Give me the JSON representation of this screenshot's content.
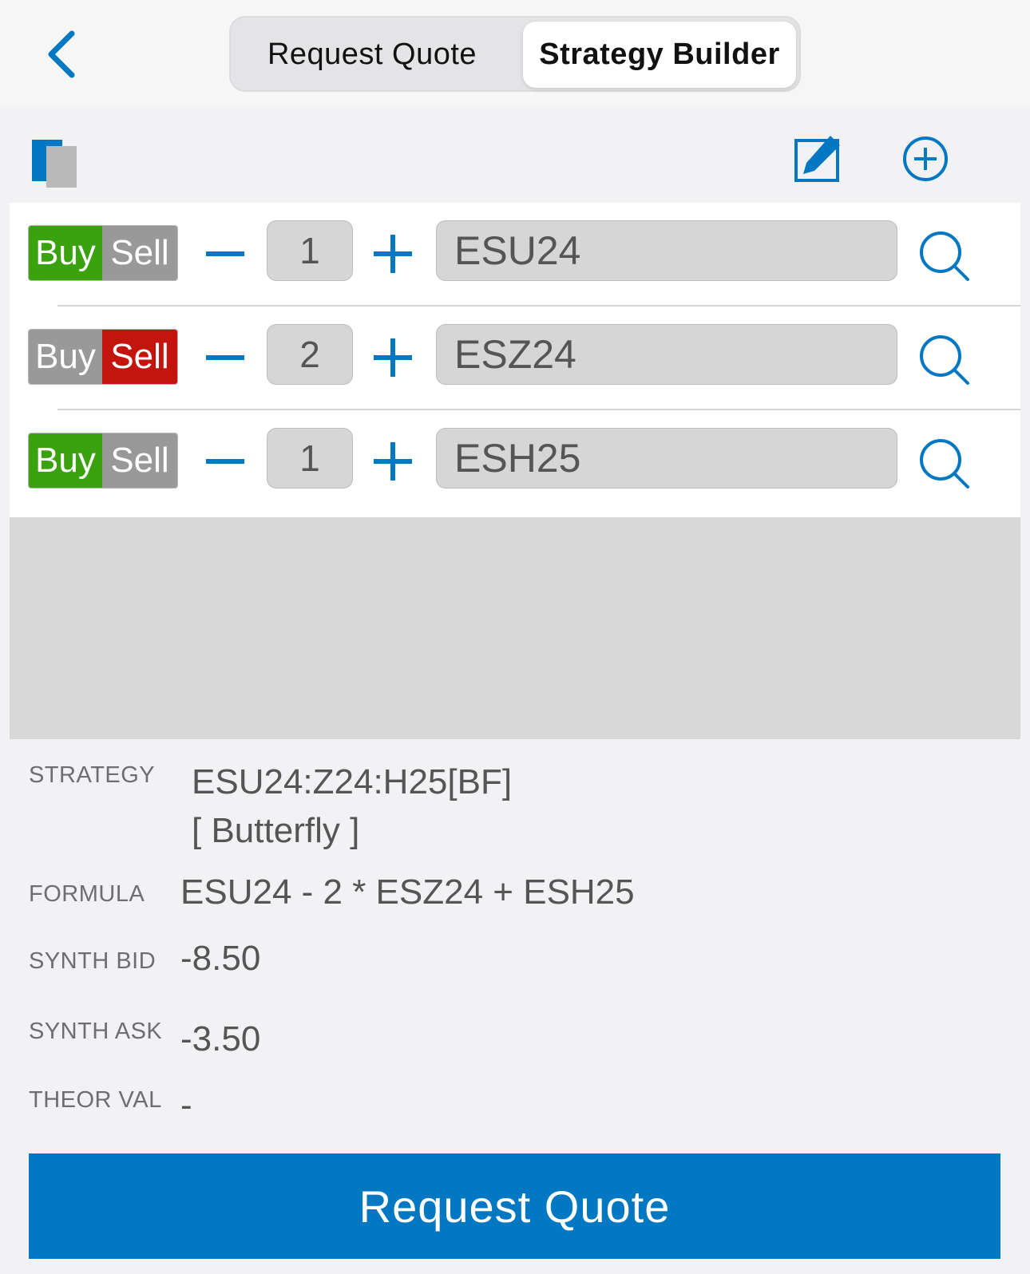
{
  "nav": {
    "tabs": [
      {
        "label": "Request Quote",
        "selected": false
      },
      {
        "label": "Strategy Builder",
        "selected": true
      }
    ]
  },
  "icons": {
    "back": "chevron-left-icon",
    "copy": "copy-icon",
    "edit": "edit-icon",
    "add": "plus-circle-icon",
    "search": "search-icon"
  },
  "legs": [
    {
      "buy_label": "Buy",
      "sell_label": "Sell",
      "side": "Buy",
      "quantity": "1",
      "symbol": "ESU24"
    },
    {
      "buy_label": "Buy",
      "sell_label": "Sell",
      "side": "Sell",
      "quantity": "2",
      "symbol": "ESZ24"
    },
    {
      "buy_label": "Buy",
      "sell_label": "Sell",
      "side": "Buy",
      "quantity": "1",
      "symbol": "ESH25"
    }
  ],
  "info": {
    "strategy_label": "STRATEGY",
    "strategy_value": "ESU24:Z24:H25[BF]",
    "strategy_type": "[ Butterfly ]",
    "formula_label": "FORMULA",
    "formula_value": "ESU24 - 2 * ESZ24 + ESH25",
    "synth_bid_label": "SYNTH BID",
    "synth_bid_value": "-8.50",
    "synth_ask_label": "SYNTH ASK",
    "synth_ask_value": "-3.50",
    "theor_val_label": "THEOR VAL",
    "theor_val_value": "-"
  },
  "actions": {
    "request_quote_label": "Request Quote"
  },
  "colors": {
    "accent": "#0277c2",
    "buy_active": "#3aa20e",
    "sell_active": "#c4140e",
    "inactive": "#999999"
  }
}
